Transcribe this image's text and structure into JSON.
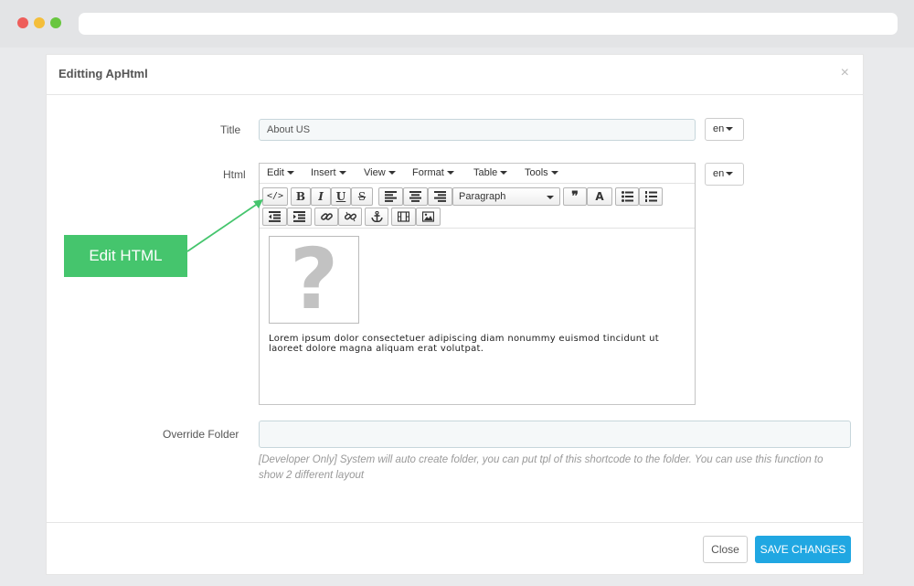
{
  "modal": {
    "title": "Editting ApHtml",
    "close_glyph": "×"
  },
  "form": {
    "title_label": "Title",
    "title_value": "About US",
    "html_label": "Html",
    "lang": "en",
    "override_label": "Override Folder",
    "override_value": "",
    "help_text": "[Developer Only] System will auto create folder, you can put tpl of this shortcode to the folder. You can use this function to show 2 different layout"
  },
  "editor": {
    "menu": [
      "Edit",
      "Insert",
      "View",
      "Format",
      "Table",
      "Tools"
    ],
    "format_select": "Paragraph",
    "toolbar_icons": [
      "code-icon",
      "bold-icon",
      "italic-icon",
      "underline-icon",
      "strikethrough-icon",
      "align-left-icon",
      "align-center-icon",
      "align-right-icon",
      "blockquote-icon",
      "clear-format-icon",
      "bullet-list-icon",
      "numbered-list-icon",
      "outdent-icon",
      "indent-icon",
      "link-icon",
      "unlink-icon",
      "anchor-icon",
      "media-icon",
      "image-icon"
    ],
    "content_text": "Lorem ipsum dolor consectetuer adipiscing diam nonummy euismod tincidunt ut laoreet dolore magna aliquam erat volutpat."
  },
  "callout": {
    "label": "Edit HTML",
    "color": "#45c56d"
  },
  "buttons": {
    "close": "Close",
    "save": "SAVE CHANGES",
    "save_color": "#20a7e2"
  }
}
